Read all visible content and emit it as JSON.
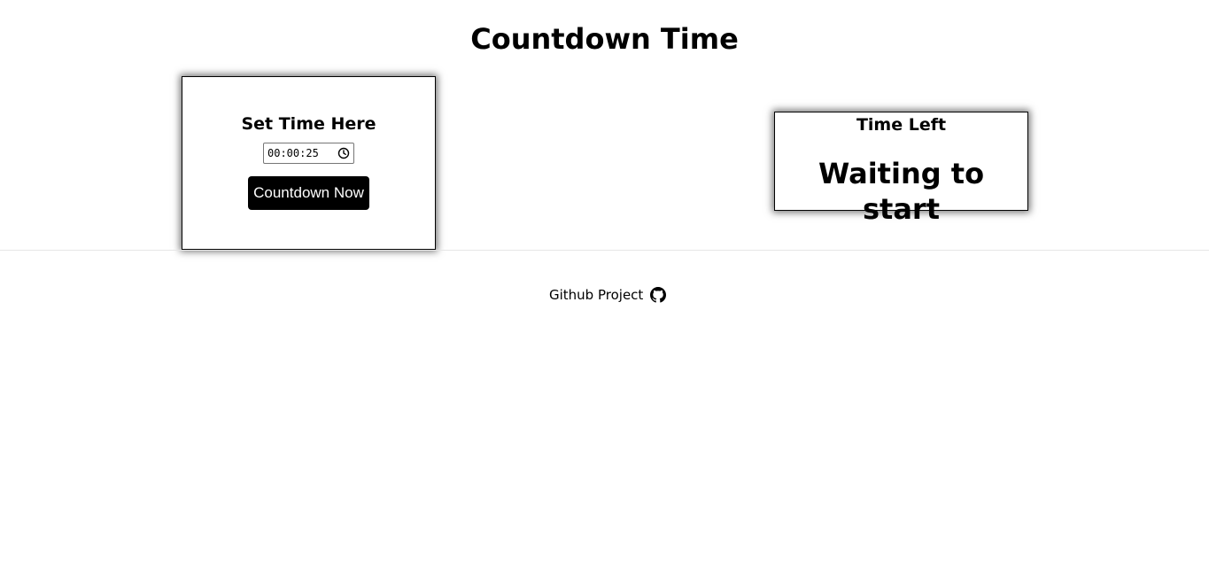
{
  "header": {
    "title": "Countdown Time"
  },
  "set_panel": {
    "heading": "Set Time Here",
    "time_value": "00:00:25",
    "button_label": "Countdown Now",
    "input_icon": "clock-icon"
  },
  "time_left_panel": {
    "heading": "Time Left",
    "status": "Waiting to start"
  },
  "footer": {
    "link_label": "Github Project",
    "link_icon": "github-icon"
  }
}
